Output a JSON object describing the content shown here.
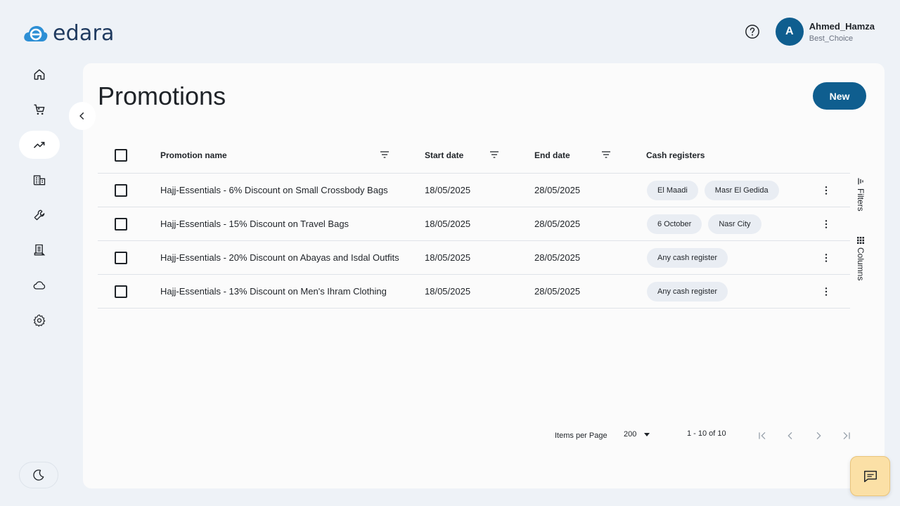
{
  "app": {
    "logo_text": "edara"
  },
  "header": {
    "avatar_initial": "A",
    "user_name": "Ahmed_Hamza",
    "org_name": "Best_Choice"
  },
  "sidebar": {
    "items": [
      {
        "icon": "home-icon"
      },
      {
        "icon": "cart-icon"
      },
      {
        "icon": "trending-up-icon",
        "active": true
      },
      {
        "icon": "building-icon"
      },
      {
        "icon": "wrench-icon"
      },
      {
        "icon": "receipt-icon"
      },
      {
        "icon": "cloud-icon"
      },
      {
        "icon": "gear-icon"
      }
    ]
  },
  "page": {
    "title": "Promotions",
    "new_button": "New"
  },
  "table": {
    "columns": {
      "name": "Promotion name",
      "start": "Start date",
      "end": "End date",
      "registers": "Cash registers"
    },
    "rows": [
      {
        "name": "Hajj-Essentials - 6% Discount on Small Crossbody Bags",
        "start": "18/05/2025",
        "end": "28/05/2025",
        "registers": [
          "El Maadi",
          "Masr El Gedida"
        ]
      },
      {
        "name": "Hajj-Essentials - 15% Discount on Travel Bags",
        "start": "18/05/2025",
        "end": "28/05/2025",
        "registers": [
          "6 October",
          "Nasr City"
        ]
      },
      {
        "name": "Hajj-Essentials - 20% Discount on Abayas and Isdal Outfits",
        "start": "18/05/2025",
        "end": "28/05/2025",
        "registers": [
          "Any cash register"
        ]
      },
      {
        "name": "Hajj-Essentials - 13% Discount on Men's Ihram Clothing",
        "start": "18/05/2025",
        "end": "28/05/2025",
        "registers": [
          "Any cash register"
        ]
      }
    ]
  },
  "side_panel": {
    "filters_label": "Filters",
    "columns_label": "Columns"
  },
  "pagination": {
    "items_per_page_label": "Items per Page",
    "page_size": "200",
    "range": "1 - 10 of 10"
  },
  "colors": {
    "primary": "#0f5e8f",
    "background": "#eef2f7",
    "chip": "#e9edf3",
    "chat_button": "#fbe0a6"
  }
}
